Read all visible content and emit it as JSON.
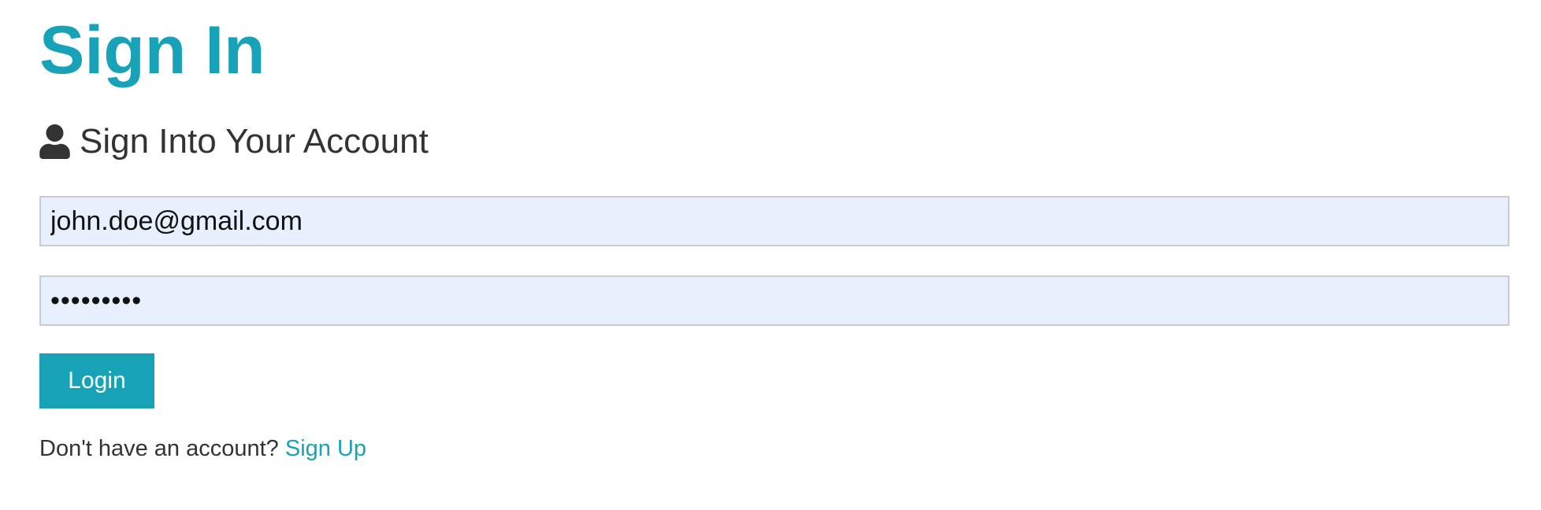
{
  "page": {
    "title": "Sign In",
    "subtitle": "Sign Into Your Account",
    "subtitle_icon": "user-icon"
  },
  "form": {
    "email": {
      "value": "john.doe@gmail.com",
      "type": "email"
    },
    "password": {
      "value": "•••••••••",
      "type": "password"
    },
    "login_label": "Login"
  },
  "footer": {
    "prompt": "Don't have an account?",
    "signup_link": "Sign Up"
  },
  "colors": {
    "accent": "#17a2b8",
    "input_background": "#e8f0fe",
    "text": "#333333"
  }
}
